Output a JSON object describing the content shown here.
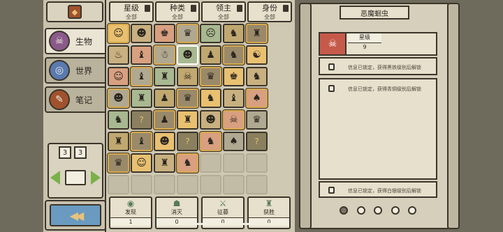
{
  "filters": [
    {
      "title": "星级",
      "sub": "全部"
    },
    {
      "title": "种类",
      "sub": "全部"
    },
    {
      "title": "领主",
      "sub": "全部"
    },
    {
      "title": "身份",
      "sub": "全部"
    }
  ],
  "side_tabs": [
    {
      "label": "生物",
      "icon": "☠"
    },
    {
      "label": "世界",
      "icon": "◎"
    },
    {
      "label": "笔记",
      "icon": "✎"
    }
  ],
  "page": {
    "current": "3",
    "total": "3"
  },
  "stats": [
    {
      "label": "发现",
      "value": "1",
      "icon": "◉"
    },
    {
      "label": "消灭",
      "value": "0",
      "icon": "☗"
    },
    {
      "label": "征募",
      "value": "0",
      "icon": "⚔"
    },
    {
      "label": "获胜",
      "value": "0",
      "icon": "♜"
    }
  ],
  "detail": {
    "title": "恶魔蛔虫",
    "level_label": "星级",
    "level_value": "9",
    "locked_1": "信息已锁定，获得黑铁级别后解锁",
    "locked_2": "信息已锁定，获得青铜级别后解锁",
    "locked_3": "信息已锁定，获得白银级别后解锁"
  },
  "grid_rows": [
    [
      "☺",
      "☻",
      "♚",
      "♛",
      "☹",
      "♞",
      "♜"
    ],
    [
      "♨",
      "♝",
      "☃",
      "☻",
      "♟",
      "♞",
      "☯"
    ],
    [
      "☺",
      "♝",
      "♜",
      "☠",
      "♛",
      "♚",
      "♞"
    ],
    [
      "☻",
      "♜",
      "♟",
      "♛",
      "♞",
      "♝",
      "♠"
    ],
    [
      "♞",
      "?",
      "♟",
      "♜",
      "☻",
      "☠",
      "♛"
    ],
    [
      "♜",
      "♝",
      "☻",
      "?",
      "♞",
      "♠",
      "?"
    ],
    [
      "♛",
      "☺",
      "♜",
      "♞",
      "",
      "",
      ""
    ],
    [
      "",
      "",
      "",
      "",
      "",
      "",
      ""
    ]
  ],
  "colors": {
    "accent_gold": "#d8a84a",
    "frame": "#3b352b",
    "bg": "#6e6a5c"
  }
}
